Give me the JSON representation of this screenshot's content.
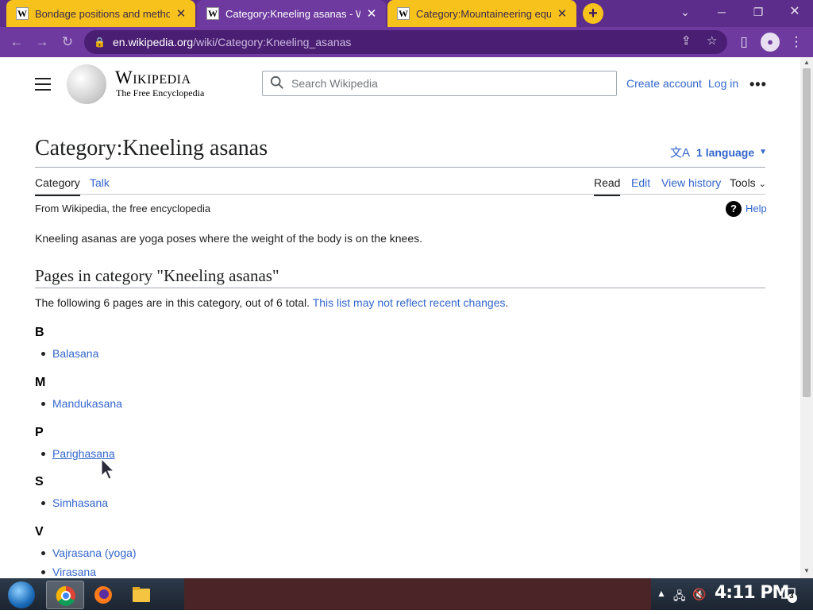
{
  "browser": {
    "tabs": [
      {
        "title": "Bondage positions and methods",
        "favicon": "W",
        "active": false
      },
      {
        "title": "Category:Kneeling asanas - Wik",
        "favicon": "W",
        "active": true
      },
      {
        "title": "Category:Mountaineering equip",
        "favicon": "W",
        "active": false
      }
    ],
    "url_host": "en.wikipedia.org",
    "url_path": "/wiki/Category:Kneeling_asanas",
    "colors": {
      "tab_strip": "#5c2d8a",
      "toolbar": "#6e3aa0",
      "inactive_tab": "#f8c21c"
    }
  },
  "header": {
    "wordmark_title": "Wikipedia",
    "wordmark_tagline": "The Free Encyclopedia",
    "search_placeholder": "Search Wikipedia",
    "create_account": "Create account",
    "log_in": "Log in"
  },
  "article": {
    "title": "Category:Kneeling asanas",
    "language_button": "1 language",
    "tabs_left": [
      "Category",
      "Talk"
    ],
    "tabs_right": [
      "Read",
      "Edit",
      "View history",
      "Tools"
    ],
    "from": "From Wikipedia, the free encyclopedia",
    "help": "Help",
    "intro": "Kneeling asanas are yoga poses where the weight of the body is on the knees.",
    "section_heading": "Pages in category \"Kneeling asanas\"",
    "count_text": "The following 6 pages are in this category, out of 6 total.",
    "count_link": "This list may not reflect recent changes",
    "count_suffix": ".",
    "groups": [
      {
        "letter": "B",
        "items": [
          "Balasana"
        ]
      },
      {
        "letter": "M",
        "items": [
          "Mandukasana"
        ]
      },
      {
        "letter": "P",
        "items": [
          "Parighasana"
        ]
      },
      {
        "letter": "S",
        "items": [
          "Simhasana"
        ]
      },
      {
        "letter": "V",
        "items": [
          "Vajrasana (yoga)",
          "Virasana"
        ]
      }
    ],
    "link_color": "#3366cc"
  },
  "taskbar": {
    "clock": "4:11 PM",
    "notification_count": "3"
  }
}
